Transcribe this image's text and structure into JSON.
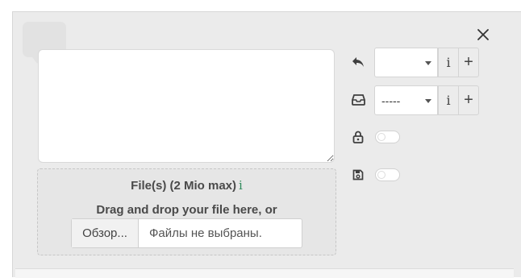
{
  "dialog": {
    "close_icon": "close-icon",
    "message": {
      "value": "",
      "placeholder": ""
    },
    "upload": {
      "title": "File(s) (2 Mio max)",
      "info_glyph": "i",
      "drag_text": "Drag and drop your file here, or",
      "browse_label": "Обзор...",
      "no_file_text": "Файлы не выбраны."
    }
  },
  "options": {
    "reply": {
      "icon": "reply-icon",
      "selected": "",
      "info": "i",
      "add": "+"
    },
    "inbox": {
      "icon": "inbox-icon",
      "selected": "-----",
      "info": "i",
      "add": "+"
    },
    "private": {
      "icon": "lock-icon",
      "on": false
    },
    "save": {
      "icon": "save-icon",
      "on": false
    }
  },
  "colors": {
    "panel_bg": "#ebebeb",
    "info_accent": "#2f8a5b"
  }
}
